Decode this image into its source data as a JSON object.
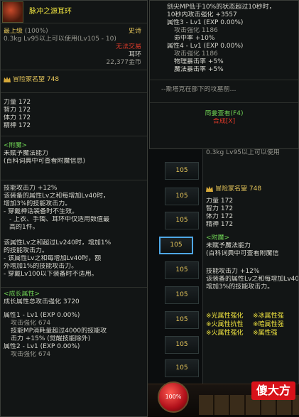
{
  "left": {
    "item_name": "脉冲之源耳环",
    "top_level": "最上级",
    "top_level_pct": "(100%)",
    "rarity": "史诗",
    "weight_req": "0.3kg  Lv95以上可以使用(Lv105 - 10)",
    "trade": "无法交易",
    "slot": "耳环",
    "price": "22,377金币",
    "fame_label": "冒险家名望",
    "fame_value": "748",
    "stats": [
      {
        "name": "力量",
        "value": "172"
      },
      {
        "name": "智力",
        "value": "172"
      },
      {
        "name": "体力",
        "value": "172"
      },
      {
        "name": "精神",
        "value": "172"
      }
    ],
    "enchant_title": "<附魔>",
    "enchant_lines": [
      "未赋予魔法能力",
      "(百科词典中可查看附魔信息)"
    ],
    "skill_lines": [
      "技能攻击力 +12%",
      "该装备的属性Lv之和每增加Lv40时，",
      "增加3%的技能攻击力。",
      "- 穿戴神话装备时不生效。",
      "- 上衣、手镯、耳环中仅适用数值最",
      "高的1件。",
      "",
      "该属性Lv之和超过Lv240时，增加1%",
      "的技能攻击力。",
      "- 该属性Lv之和每增加Lv40时，额",
      "外增加1%的技能攻击力。",
      "- 穿戴Lv100以下装备时不适用。"
    ],
    "growth_title": "<成长属性>",
    "growth_total": "成长属性总攻击强化 3720",
    "growth_lines": [
      "属性1 - Lv1 (EXP 0.00%)",
      "攻击强化 674",
      "技能MP消耗量超过4000的技能攻",
      "击力 +15% (觉醒技能除外)",
      "属性2 - Lv1 (EXP 0.00%)",
      "攻击强化 674"
    ]
  },
  "top_right": {
    "lines": [
      "剑尖MP低于10%的状态超过10秒时，",
      "10秒内攻击强化 +3557",
      "属性3 - Lv1 (EXP 0.00%)",
      "攻击强化 1186",
      "命中率 +10%",
      "属性4 - Lv1 (EXP 0.00%)",
      "攻击强化 1186",
      "物理暴击率 +5%",
      "魔法暴击率 +5%"
    ],
    "desc": "--斯塔克在部下的坟墓前…",
    "view_detail": "简要查看(F4)",
    "synth": "合成[X]"
  },
  "right": {
    "weight_req": "0.3kg  Lv95以上可以使用",
    "fame_label": "冒险家名望",
    "fame_value": "748",
    "stats": [
      {
        "name": "力量",
        "value": "172"
      },
      {
        "name": "智力",
        "value": "172"
      },
      {
        "name": "体力",
        "value": "172"
      },
      {
        "name": "精神",
        "value": "172"
      }
    ],
    "enchant_title": "<附魔>",
    "enchant_lines": [
      "未赋予魔法能力",
      "(百科词典中可查看附魔信"
    ],
    "skill_lines": [
      "技能攻击力 +12%",
      "该装备的属性Lv之和每增加Lv40",
      "增加3%的技能攻击力。"
    ],
    "attr_tags": [
      "※光属性强化",
      "※冰属性强",
      "※火属性抗性",
      "※暗属性强",
      "※火属性强化",
      "※属性强"
    ]
  },
  "buttons": [
    "105",
    "105",
    "105",
    "105",
    "105",
    "105",
    "105",
    "105",
    "105",
    "105"
  ],
  "hp_orb": "100%",
  "watermark": "傻大方"
}
